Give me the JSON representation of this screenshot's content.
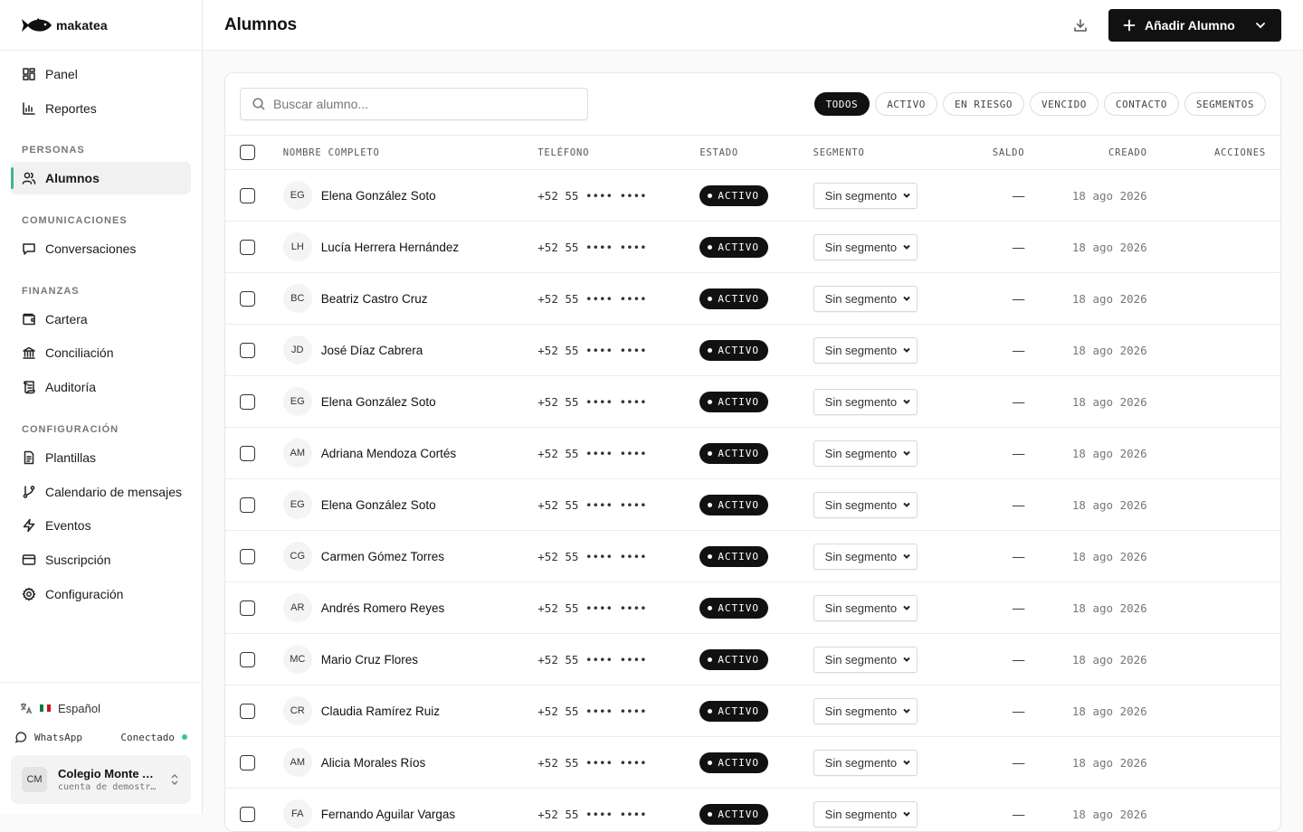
{
  "brand": {
    "name": "makatea"
  },
  "nav": {
    "top": [
      {
        "label": "Panel",
        "icon": "grid-icon"
      },
      {
        "label": "Reportes",
        "icon": "bar-chart-icon"
      }
    ],
    "sections": [
      {
        "title": "PERSONAS",
        "items": [
          {
            "label": "Alumnos",
            "icon": "users-icon",
            "active": true
          }
        ]
      },
      {
        "title": "COMUNICACIONES",
        "items": [
          {
            "label": "Conversaciones",
            "icon": "message-icon"
          }
        ]
      },
      {
        "title": "FINANZAS",
        "items": [
          {
            "label": "Cartera",
            "icon": "wallet-icon"
          },
          {
            "label": "Conciliación",
            "icon": "bank-icon"
          },
          {
            "label": "Auditoría",
            "icon": "scroll-icon"
          }
        ]
      },
      {
        "title": "CONFIGURACIÓN",
        "items": [
          {
            "label": "Plantillas",
            "icon": "file-icon"
          },
          {
            "label": "Calendario de mensajes",
            "icon": "git-branch-icon"
          },
          {
            "label": "Eventos",
            "icon": "zap-icon"
          },
          {
            "label": "Suscripción",
            "icon": "credit-card-icon"
          },
          {
            "label": "Configuración",
            "icon": "gear-icon"
          }
        ]
      }
    ]
  },
  "footer": {
    "language": "Español",
    "whatsapp_label": "WhatsApp",
    "whatsapp_status": "Conectado",
    "org_initials": "CM",
    "org_name": "Colegio Monte A...",
    "org_sub": "cuenta de demostr..."
  },
  "header": {
    "title": "Alumnos",
    "primary_button": "Añadir Alumno"
  },
  "search": {
    "placeholder": "Buscar alumno..."
  },
  "filters": [
    "TODOS",
    "ACTIVO",
    "EN RIESGO",
    "VENCIDO",
    "CONTACTO",
    "SEGMENTOS"
  ],
  "active_filter": "TODOS",
  "table": {
    "columns": {
      "name": "NOMBRE COMPLETO",
      "phone": "TELÉFONO",
      "status": "ESTADO",
      "segment": "SEGMENTO",
      "balance": "SALDO",
      "created": "CREADO",
      "actions": "ACCIONES"
    },
    "rows": [
      {
        "initials": "EG",
        "name": "Elena González Soto",
        "phone": "+52 55 •••• ••••",
        "status": "ACTIVO",
        "segment": "Sin segmento",
        "balance": "—",
        "created": "18 ago 2026"
      },
      {
        "initials": "LH",
        "name": "Lucía Herrera Hernández",
        "phone": "+52 55 •••• ••••",
        "status": "ACTIVO",
        "segment": "Sin segmento",
        "balance": "—",
        "created": "18 ago 2026"
      },
      {
        "initials": "BC",
        "name": "Beatriz Castro Cruz",
        "phone": "+52 55 •••• ••••",
        "status": "ACTIVO",
        "segment": "Sin segmento",
        "balance": "—",
        "created": "18 ago 2026"
      },
      {
        "initials": "JD",
        "name": "José Díaz Cabrera",
        "phone": "+52 55 •••• ••••",
        "status": "ACTIVO",
        "segment": "Sin segmento",
        "balance": "—",
        "created": "18 ago 2026"
      },
      {
        "initials": "EG",
        "name": "Elena González Soto",
        "phone": "+52 55 •••• ••••",
        "status": "ACTIVO",
        "segment": "Sin segmento",
        "balance": "—",
        "created": "18 ago 2026"
      },
      {
        "initials": "AM",
        "name": "Adriana Mendoza Cortés",
        "phone": "+52 55 •••• ••••",
        "status": "ACTIVO",
        "segment": "Sin segmento",
        "balance": "—",
        "created": "18 ago 2026"
      },
      {
        "initials": "EG",
        "name": "Elena González Soto",
        "phone": "+52 55 •••• ••••",
        "status": "ACTIVO",
        "segment": "Sin segmento",
        "balance": "—",
        "created": "18 ago 2026"
      },
      {
        "initials": "CG",
        "name": "Carmen Gómez Torres",
        "phone": "+52 55 •••• ••••",
        "status": "ACTIVO",
        "segment": "Sin segmento",
        "balance": "—",
        "created": "18 ago 2026"
      },
      {
        "initials": "AR",
        "name": "Andrés Romero Reyes",
        "phone": "+52 55 •••• ••••",
        "status": "ACTIVO",
        "segment": "Sin segmento",
        "balance": "—",
        "created": "18 ago 2026"
      },
      {
        "initials": "MC",
        "name": "Mario Cruz Flores",
        "phone": "+52 55 •••• ••••",
        "status": "ACTIVO",
        "segment": "Sin segmento",
        "balance": "—",
        "created": "18 ago 2026"
      },
      {
        "initials": "CR",
        "name": "Claudia Ramírez Ruiz",
        "phone": "+52 55 •••• ••••",
        "status": "ACTIVO",
        "segment": "Sin segmento",
        "balance": "—",
        "created": "18 ago 2026"
      },
      {
        "initials": "AM",
        "name": "Alicia Morales Ríos",
        "phone": "+52 55 •••• ••••",
        "status": "ACTIVO",
        "segment": "Sin segmento",
        "balance": "—",
        "created": "18 ago 2026"
      },
      {
        "initials": "FA",
        "name": "Fernando Aguilar Vargas",
        "phone": "+52 55 •••• ••••",
        "status": "ACTIVO",
        "segment": "Sin segmento",
        "balance": "—",
        "created": "18 ago 2026"
      }
    ]
  },
  "colors": {
    "accent": "#3fb58d",
    "primary": "#111111",
    "status_dot": "#37c59a"
  }
}
